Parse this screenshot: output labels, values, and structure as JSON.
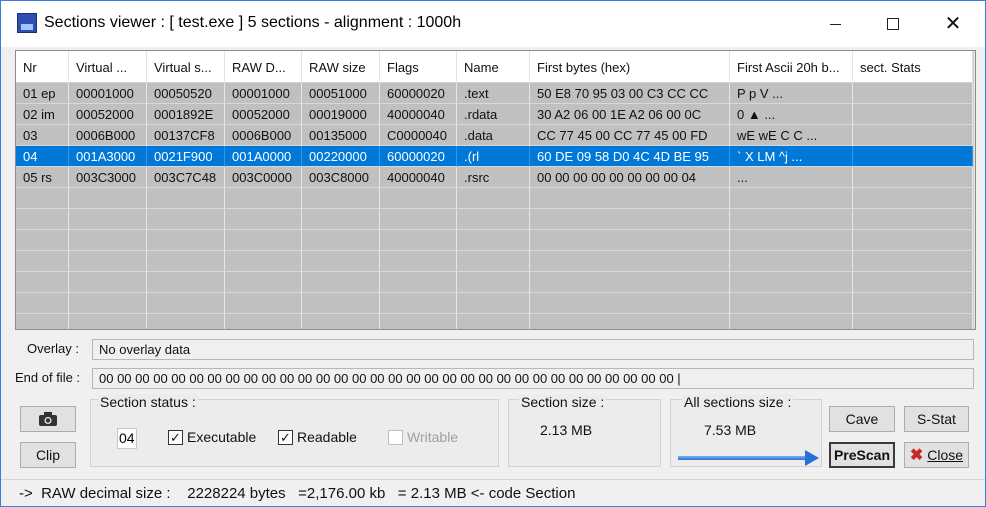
{
  "window": {
    "title": "Sections viewer :  [ test.exe ] 5 sections - alignment : 1000h"
  },
  "table": {
    "columns": [
      "Nr",
      "Virtual ...",
      "Virtual s...",
      "RAW D...",
      "RAW size",
      "Flags",
      "Name",
      "First bytes (hex)",
      "First Ascii 20h b...",
      "sect. Stats"
    ],
    "rows": [
      [
        "01 ep",
        "00001000",
        "00050520",
        "00001000",
        "00051000",
        "60000020",
        ".text",
        "50 E8 70 95 03 00 C3 CC CC",
        "P p          V  ...",
        ""
      ],
      [
        "02 im",
        "00052000",
        "0001892E",
        "00052000",
        "00019000",
        "40000040",
        ".rdata",
        "30 A2 06 00 1E A2 06 00 0C",
        "0         ▲      ...",
        ""
      ],
      [
        "03",
        "0006B000",
        "00137CF8",
        "0006B000",
        "00135000",
        "C0000040",
        ".data",
        "CC 77 45 00 CC 77 45 00 FD",
        " wE  wE   C   C  ...",
        ""
      ],
      [
        "04",
        "001A3000",
        "0021F900",
        "001A0000",
        "00220000",
        "60000020",
        ".(rl",
        "60 DE 09 58 D0 4C 4D BE 95",
        "` X LM      ^j    ...",
        ""
      ],
      [
        "05 rs",
        "003C3000",
        "003C7C48",
        "003C0000",
        "003C8000",
        "40000040",
        ".rsrc",
        "00 00 00 00 00 00 00 00 04",
        "                    ...",
        ""
      ]
    ],
    "selected_row": 3
  },
  "overlay": {
    "label": "Overlay :",
    "value": "No overlay data"
  },
  "end_of_file": {
    "label": "End of file :",
    "value": "00 00 00 00 00 00 00 00 00 00 00 00 00 00 00 00 00 00 00 00 00 00 00 00 00 00 00 00 00 00 00 00   |"
  },
  "section_status": {
    "label": "Section status :",
    "section_number": "04",
    "executable_label": "Executable",
    "readable_label": "Readable",
    "writable_label": "Writable",
    "executable": true,
    "readable": true,
    "writable": false
  },
  "section_size": {
    "label": "Section size :",
    "value": "2.13 MB"
  },
  "all_sections_size": {
    "label": "All sections size :",
    "value": "7.53 MB"
  },
  "buttons": {
    "camera_icon": "camera-icon",
    "clip": "Clip",
    "cave": "Cave",
    "s_stat": "S-Stat",
    "prescan": "PreScan",
    "close": "Close"
  },
  "status_bar": {
    "text": "->  RAW decimal size :    2228224 bytes   =2,176.00 kb   = 2.13 MB <- code Section"
  },
  "colors": {
    "selection": "#0078d7",
    "grid_background": "#c0c0c0",
    "window_background": "#f0f0f0",
    "arrow": "#2a6fd6"
  }
}
